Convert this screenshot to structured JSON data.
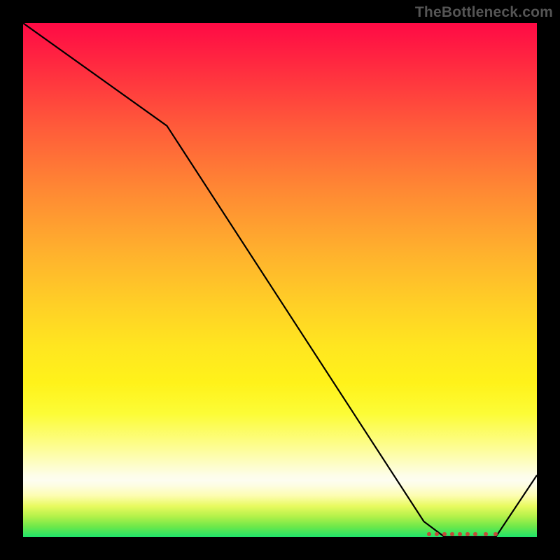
{
  "credit_text": "TheBottleneck.com",
  "colors": {
    "page_bg": "#000000",
    "curve": "#000000",
    "marker": "#c34a3a"
  },
  "chart_data": {
    "type": "line",
    "title": "",
    "xlabel": "",
    "ylabel": "",
    "xlim": [
      0,
      100
    ],
    "ylim": [
      0,
      100
    ],
    "grid": false,
    "legend": false,
    "series": [
      {
        "name": "curve",
        "x": [
          0,
          28,
          78,
          82,
          92,
          100
        ],
        "values": [
          100,
          80,
          3,
          0,
          0,
          12
        ]
      }
    ],
    "markers": {
      "y": 0.5,
      "x": [
        79,
        80.5,
        82,
        83.5,
        85,
        86.5,
        88,
        90,
        92
      ]
    }
  }
}
